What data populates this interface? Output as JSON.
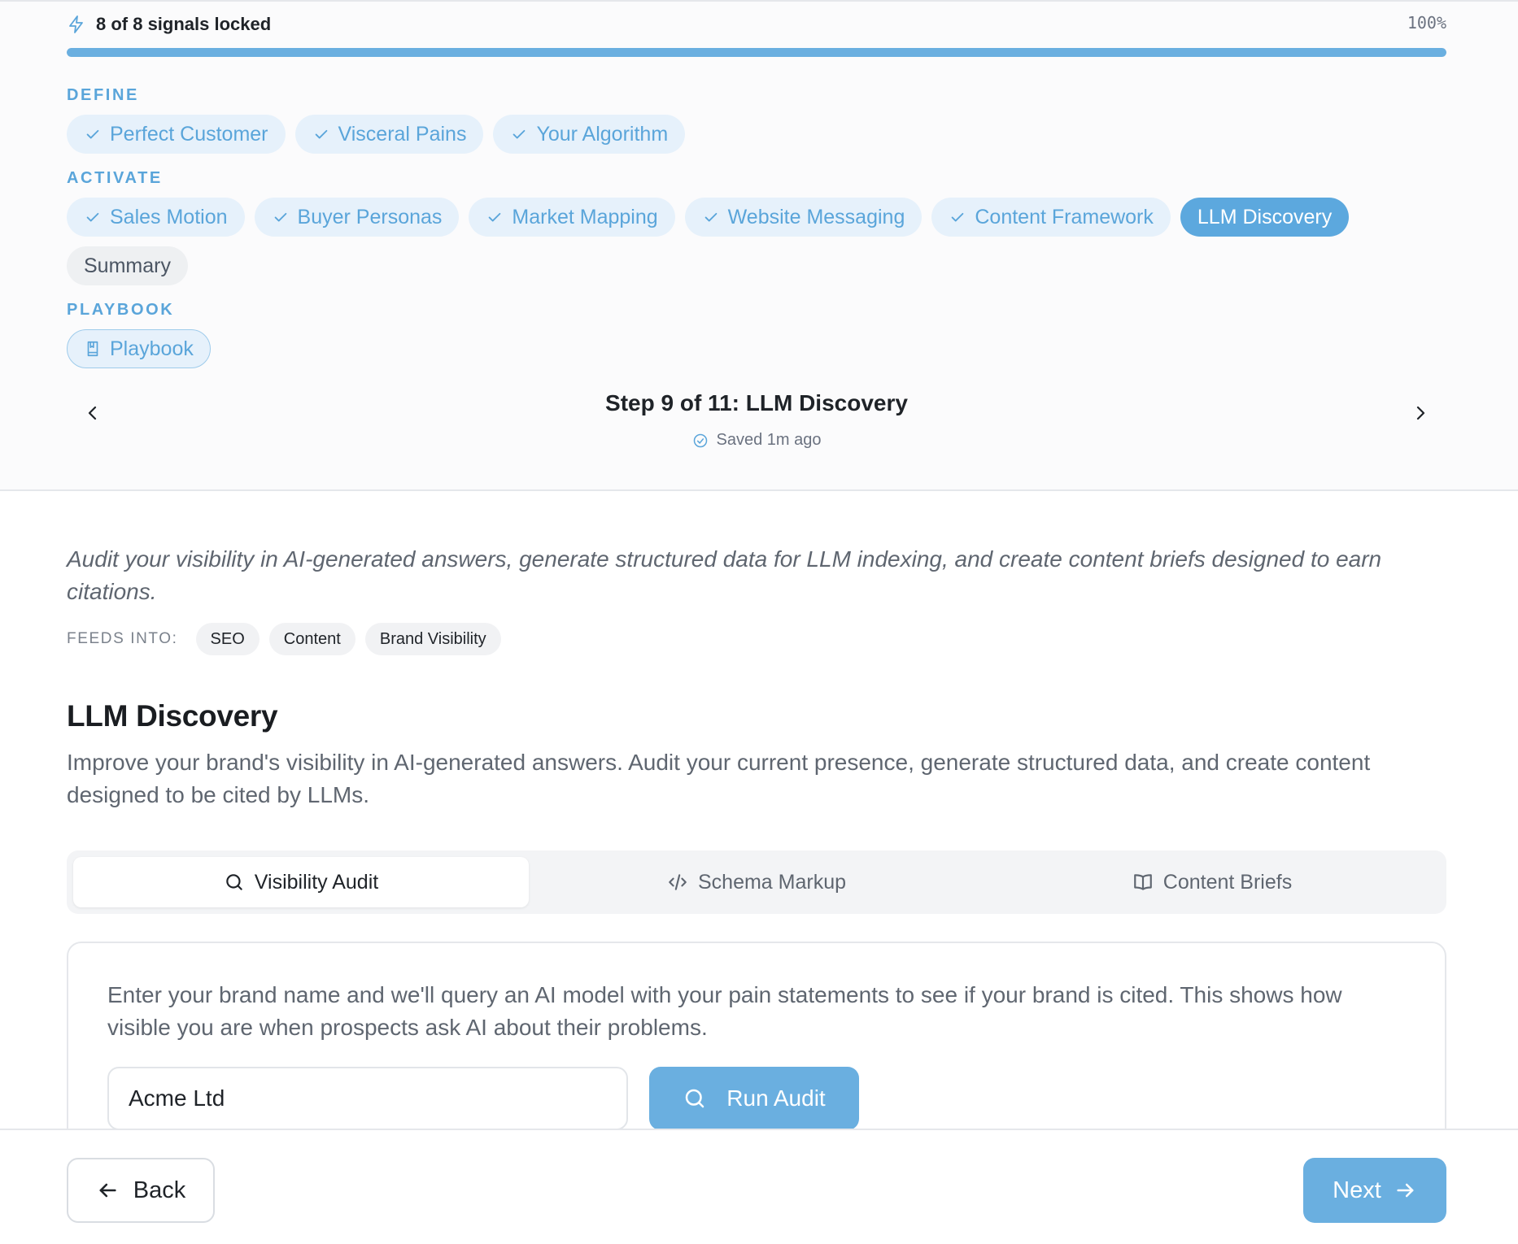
{
  "progress": {
    "signals_text": "8 of 8 signals locked",
    "percent_text": "100%",
    "fraction": 1.0,
    "icon": "lightning-icon"
  },
  "sections": {
    "define": {
      "label": "DEFINE",
      "items": [
        {
          "label": "Perfect Customer",
          "state": "complete"
        },
        {
          "label": "Visceral Pains",
          "state": "complete"
        },
        {
          "label": "Your Algorithm",
          "state": "complete"
        }
      ]
    },
    "activate": {
      "label": "ACTIVATE",
      "items": [
        {
          "label": "Sales Motion",
          "state": "complete"
        },
        {
          "label": "Buyer Personas",
          "state": "complete"
        },
        {
          "label": "Market Mapping",
          "state": "complete"
        },
        {
          "label": "Website Messaging",
          "state": "complete"
        },
        {
          "label": "Content Framework",
          "state": "complete"
        },
        {
          "label": "LLM Discovery",
          "state": "active"
        },
        {
          "label": "Summary",
          "state": "pending"
        }
      ]
    },
    "playbook": {
      "label": "PLAYBOOK",
      "items": [
        {
          "label": "Playbook",
          "state": "outline",
          "icon": "book-icon"
        }
      ]
    }
  },
  "step": {
    "title": "Step 9 of 11: LLM Discovery",
    "saved": "Saved 1m ago"
  },
  "intro": "Audit your visibility in AI-generated answers, generate structured data for LLM indexing, and create content briefs designed to earn citations.",
  "feeds": {
    "label": "FEEDS INTO:",
    "tags": [
      "SEO",
      "Content",
      "Brand Visibility"
    ]
  },
  "main": {
    "title": "LLM Discovery",
    "description": "Improve your brand's visibility in AI-generated answers. Audit your current presence, generate structured data, and create content designed to be cited by LLMs."
  },
  "tabs": [
    {
      "label": "Visibility Audit",
      "icon": "search-icon",
      "active": true
    },
    {
      "label": "Schema Markup",
      "icon": "code-icon",
      "active": false
    },
    {
      "label": "Content Briefs",
      "icon": "open-book-icon",
      "active": false
    }
  ],
  "audit": {
    "instructions": "Enter your brand name and we'll query an AI model with your pain statements to see if your brand is cited. This shows how visible you are when prospects ask AI about their problems.",
    "brand_value": "Acme Ltd",
    "run_label": "Run Audit"
  },
  "footer": {
    "back_label": "Back",
    "next_label": "Next"
  },
  "colors": {
    "accent": "#6aafe0",
    "chip_bg": "#e6f1fb",
    "chip_text": "#5aa5da",
    "active_chip": "#5ca8de"
  }
}
